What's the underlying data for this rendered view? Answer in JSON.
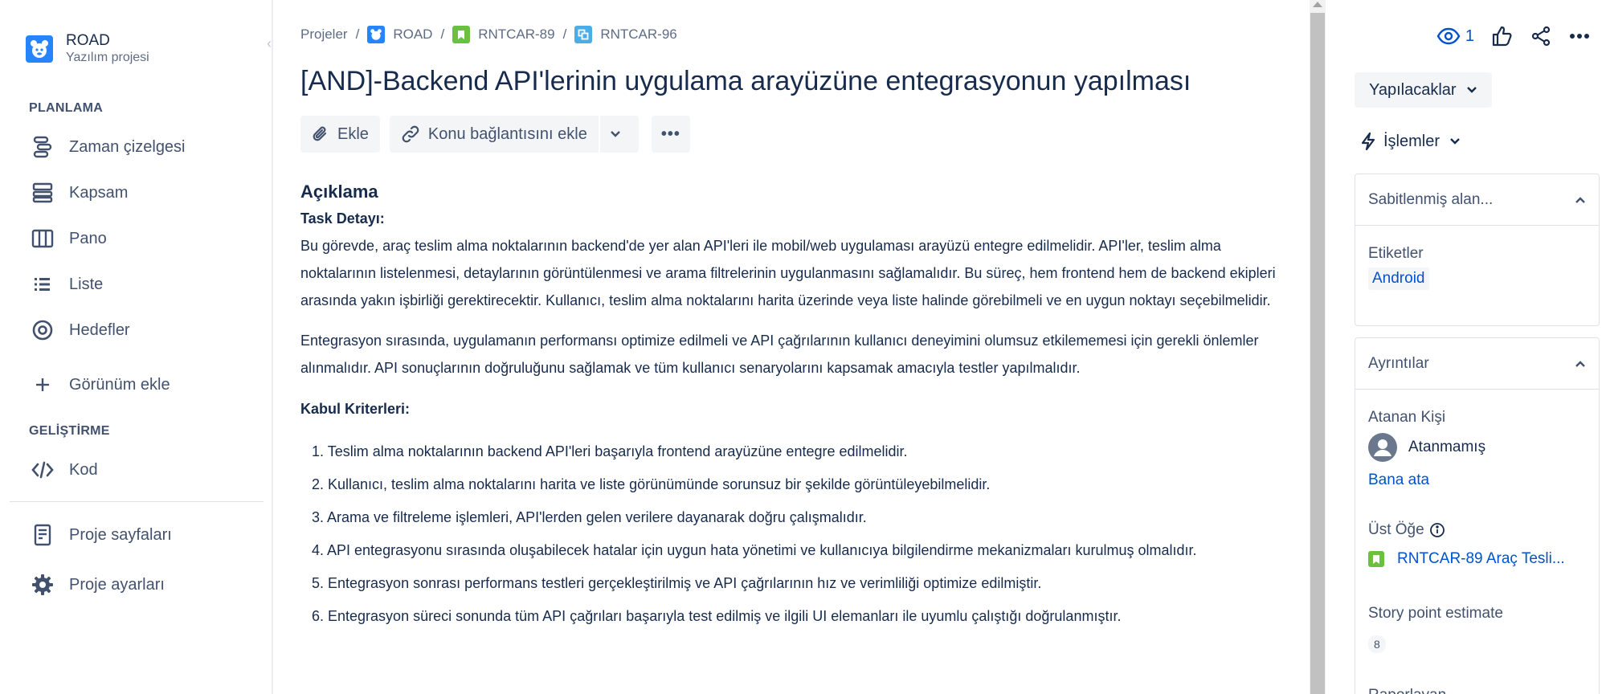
{
  "project": {
    "name": "ROAD",
    "type": "Yazılım projesi"
  },
  "sidebar": {
    "section_planning": "PLANLAMA",
    "planning_items": [
      {
        "label": "Zaman çizelgesi",
        "icon": "timeline-icon"
      },
      {
        "label": "Kapsam",
        "icon": "backlog-icon"
      },
      {
        "label": "Pano",
        "icon": "board-icon"
      },
      {
        "label": "Liste",
        "icon": "list-icon"
      },
      {
        "label": "Hedefler",
        "icon": "goals-icon"
      }
    ],
    "add_view": "Görünüm ekle",
    "section_dev": "GELİŞTİRME",
    "dev_items": [
      {
        "label": "Kod",
        "icon": "code-icon"
      }
    ],
    "bottom_items": [
      {
        "label": "Proje sayfaları",
        "icon": "pages-icon"
      },
      {
        "label": "Proje ayarları",
        "icon": "settings-icon"
      }
    ]
  },
  "breadcrumb": {
    "projects": "Projeler",
    "project": "ROAD",
    "epic": "RNTCAR-89",
    "issue": "RNTCAR-96",
    "separator": "/"
  },
  "issue": {
    "title": "[AND]-Backend API'lerinin uygulama arayüzüne entegrasyonun yapılması"
  },
  "toolbar": {
    "attach": "Ekle",
    "link_issue": "Konu bağlantısını ekle",
    "more": "•••"
  },
  "description": {
    "heading": "Açıklama",
    "task_heading": "Task Detayı:",
    "paragraphs": [
      "Bu görevde, araç teslim alma noktalarının backend'de yer alan API'leri ile mobil/web uygulaması arayüzü entegre edilmelidir. API'ler, teslim alma noktalarının listelenmesi, detaylarının görüntülenmesi ve arama filtrelerinin uygulanmasını sağlamalıdır. Bu süreç, hem frontend hem de backend ekipleri arasında yakın işbirliği gerektirecektir. Kullanıcı, teslim alma noktalarını harita üzerinde veya liste halinde görebilmeli ve en uygun noktayı seçebilmelidir.",
      "Entegrasyon sırasında, uygulamanın performansı optimize edilmeli ve API çağrılarının kullanıcı deneyimini olumsuz etkilememesi için gerekli önlemler alınmalıdır. API sonuçlarının doğruluğunu sağlamak ve tüm kullanıcı senaryolarını kapsamak amacıyla testler yapılmalıdır."
    ],
    "criteria_heading": "Kabul Kriterleri:",
    "criteria": [
      "1. Teslim alma noktalarının backend API'leri başarıyla frontend arayüzüne entegre edilmelidir.",
      "2. Kullanıcı, teslim alma noktalarını harita ve liste görünümünde sorunsuz bir şekilde görüntüleyebilmelidir.",
      "3. Arama ve filtreleme işlemleri, API'lerden gelen verilere dayanarak doğru çalışmalıdır.",
      "4. API entegrasyonu sırasında oluşabilecek hatalar için uygun hata yönetimi ve kullanıcıya bilgilendirme mekanizmaları kurulmuş olmalıdır.",
      "5. Entegrasyon sonrası performans testleri gerçekleştirilmiş ve API çağrılarının hız ve verimliliği optimize edilmiştir.",
      "6. Entegrasyon süreci sonunda tüm API çağrıları başarıyla test edilmiş ve ilgili UI elemanları ile uyumlu çalıştığı doğrulanmıştır."
    ]
  },
  "right": {
    "watch_count": "1",
    "status": "Yapılacaklar",
    "actions": "İşlemler",
    "pinned_heading": "Sabitlenmiş alan...",
    "labels_label": "Etiketler",
    "label_value": "Android",
    "details_heading": "Ayrıntılar",
    "assignee_label": "Atanan Kişi",
    "assignee_value": "Atanmamış",
    "assign_me": "Bana ata",
    "parent_label": "Üst Öğe",
    "parent_value": "RNTCAR-89 Araç Tesli...",
    "story_points_label": "Story point estimate",
    "story_points_value": "8",
    "reporter_label": "Raporlayan"
  },
  "colors": {
    "accent": "#0052cc",
    "epic_green": "#6bc03f",
    "subtask_blue": "#4bade8",
    "project_blue": "#2684ff"
  }
}
